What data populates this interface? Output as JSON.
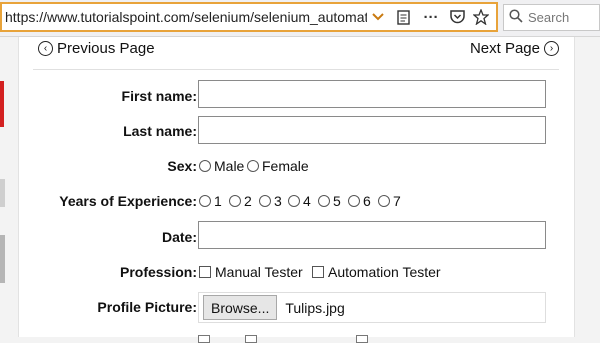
{
  "browser": {
    "url": "https://www.tutorialspoint.com/selenium/selenium_automation_pra",
    "search_placeholder": "Search"
  },
  "pager": {
    "previous_label": "Previous Page",
    "next_label": "Next Page"
  },
  "form": {
    "first_name_label": "First name:",
    "first_name_value": "",
    "last_name_label": "Last name:",
    "last_name_value": "",
    "sex_label": "Sex:",
    "sex_options": [
      "Male",
      "Female"
    ],
    "experience_label": "Years of Experience:",
    "experience_options": [
      "1",
      "2",
      "3",
      "4",
      "5",
      "6",
      "7"
    ],
    "date_label": "Date:",
    "date_value": "",
    "profession_label": "Profession:",
    "profession_options": [
      "Manual Tester",
      "Automation Tester"
    ],
    "profile_label": "Profile Picture:",
    "browse_label": "Browse...",
    "file_name": "Tulips.jpg"
  }
}
